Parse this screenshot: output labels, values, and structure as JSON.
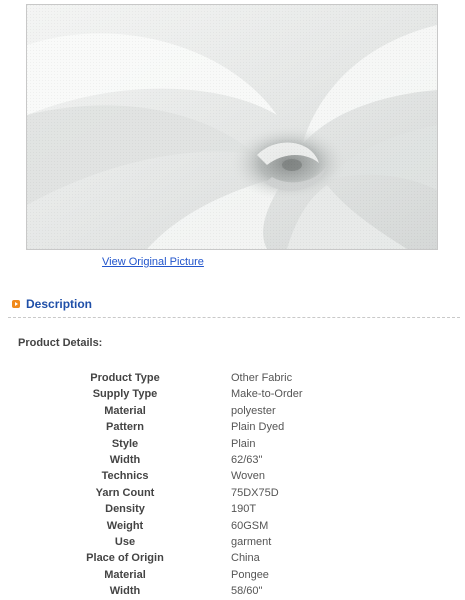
{
  "product_image": {
    "alt": "White woven fabric swirl",
    "view_link_label": "View Original Picture"
  },
  "section": {
    "title": "Description",
    "product_details_label": "Product Details:"
  },
  "specs": [
    {
      "key": "Product Type",
      "value": "Other Fabric"
    },
    {
      "key": "Supply Type",
      "value": "Make-to-Order"
    },
    {
      "key": "Material",
      "value": "polyester"
    },
    {
      "key": "Pattern",
      "value": "Plain Dyed"
    },
    {
      "key": "Style",
      "value": "Plain"
    },
    {
      "key": "Width",
      "value": "62/63\""
    },
    {
      "key": "Technics",
      "value": "Woven"
    },
    {
      "key": "Yarn Count",
      "value": "75DX75D"
    },
    {
      "key": "Density",
      "value": "190T"
    },
    {
      "key": "Weight",
      "value": "60GSM"
    },
    {
      "key": "Use",
      "value": "garment"
    },
    {
      "key": "Place of Origin",
      "value": "China"
    },
    {
      "key": "Material",
      "value": "Pongee"
    },
    {
      "key": "Width",
      "value": "58/60\""
    }
  ],
  "colors": {
    "link": "#2255cc",
    "section_title": "#1f4fa8",
    "bullet": "#f08a1c"
  }
}
